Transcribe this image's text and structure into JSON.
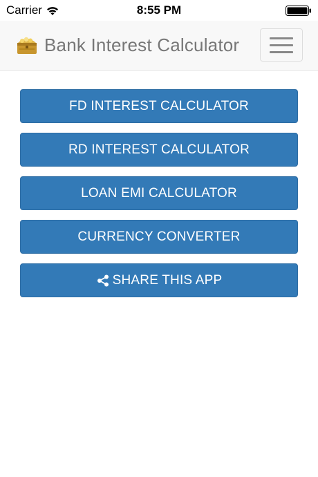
{
  "status_bar": {
    "carrier": "Carrier",
    "time": "8:55 PM",
    "wifi_icon": "wifi-icon",
    "battery_icon": "battery-icon"
  },
  "navbar": {
    "title": "Bank Interest Calculator",
    "brand_icon": "treasure-chest-icon",
    "menu_icon": "hamburger-menu-icon"
  },
  "buttons": [
    {
      "label": "FD INTEREST CALCULATOR"
    },
    {
      "label": "RD INTEREST CALCULATOR"
    },
    {
      "label": "LOAN EMI CALCULATOR"
    },
    {
      "label": "CURRENCY CONVERTER"
    },
    {
      "label": "SHARE THIS APP",
      "icon": "share-icon"
    }
  ],
  "colors": {
    "button_bg": "#337ab7",
    "button_border": "#2e6da4",
    "navbar_bg": "#f8f8f8",
    "title_text": "#777777"
  }
}
